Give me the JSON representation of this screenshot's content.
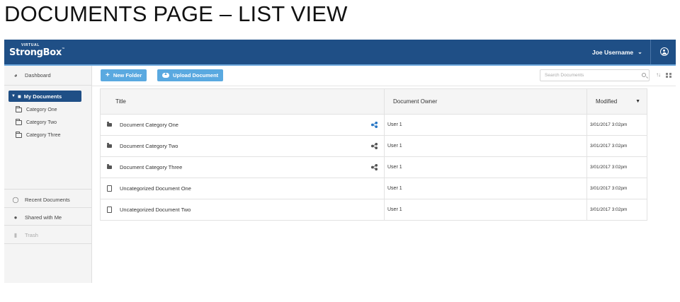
{
  "slide": {
    "title": "DOCUMENTS PAGE – LIST VIEW"
  },
  "header": {
    "brand_small": "VIRTUAL",
    "brand_main": "StrongBox",
    "brand_tm": "™",
    "user_name": "Joe Username",
    "chevron": "⌄",
    "icons": {
      "chevron": "chevron-down-icon",
      "account": "account-icon"
    }
  },
  "sidebar": {
    "dashboard": "Dashboard",
    "my_documents": "My Documents",
    "categories": [
      "Category One",
      "Category Two",
      "Category Three"
    ],
    "recent": "Recent Documents",
    "shared": "Shared with Me",
    "trash": "Trash",
    "icons": {
      "dashboard": "gauge-icon",
      "my_documents": "folder-open-icon",
      "category": "folder-outline-icon",
      "recent": "clock-icon",
      "shared": "users-icon",
      "trash": "trash-icon"
    }
  },
  "toolbar": {
    "new_folder": "New Folder",
    "upload": "Upload Document",
    "search_placeholder": "Search Documents",
    "icons": {
      "new_folder": "plus-icon",
      "upload": "cloud-upload-icon",
      "search": "search-icon",
      "sort": "sort-icon",
      "grid": "grid-view-icon"
    }
  },
  "table": {
    "columns": {
      "title": "Title",
      "owner": "Document Owner",
      "modified": "Modified"
    },
    "rows": [
      {
        "title": "Document Category One",
        "owner": "User 1",
        "modified": "3/01/2017 3:02pm",
        "type": "folder",
        "share_color": "#2a78c6"
      },
      {
        "title": "Document Category Two",
        "owner": "User 1",
        "modified": "3/01/2017 3:02pm",
        "type": "folder",
        "share_color": "#555555"
      },
      {
        "title": "Document Category Three",
        "owner": "User 1",
        "modified": "3/01/2017 3:02pm",
        "type": "folder",
        "share_color": "#555555"
      },
      {
        "title": "Uncategorized Document One",
        "owner": "User 1",
        "modified": "3/01/2017 3:02pm",
        "type": "document"
      },
      {
        "title": "Uncategorized Document Two",
        "owner": "User 1",
        "modified": "3/01/2017 3:02pm",
        "type": "document"
      }
    ]
  },
  "colors": {
    "topbar": "#1f4f86",
    "accent": "#5aa9e0",
    "highlight": "#6fa8dc"
  }
}
